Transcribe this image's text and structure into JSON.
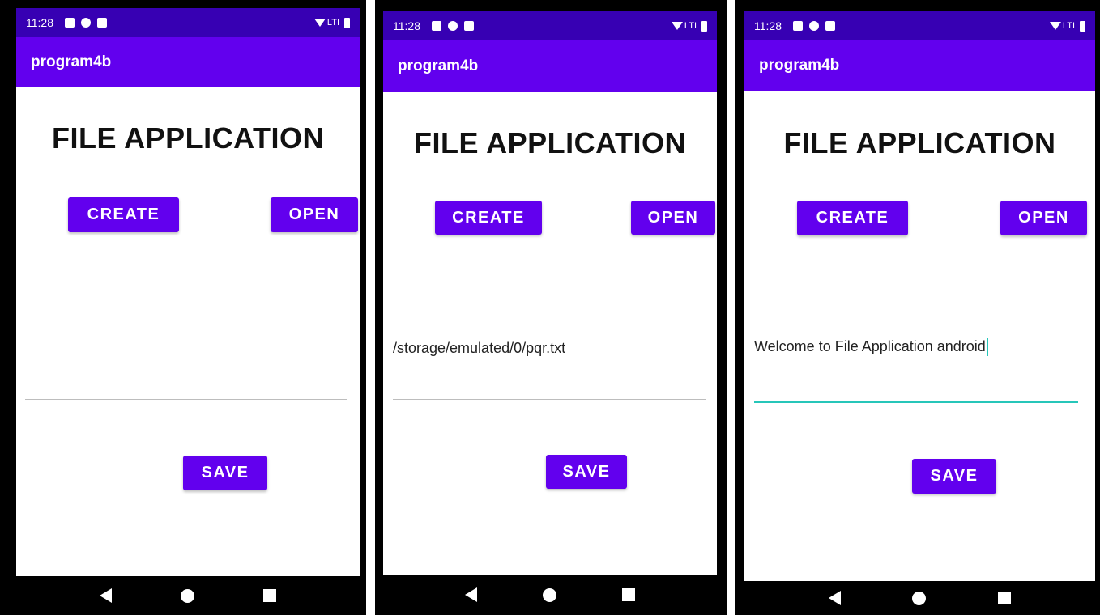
{
  "status_time": "11:28",
  "signal_text": "LTI",
  "app_title": "program4b",
  "heading": "FILE APPLICATION",
  "buttons": {
    "create": "CREATE",
    "open": "OPEN",
    "save": "SAVE"
  },
  "screens": [
    {
      "field_value": ""
    },
    {
      "field_value": "/storage/emulated/0/pqr.txt"
    },
    {
      "field_value": "Welcome to File Application android"
    }
  ],
  "colors": {
    "status_bar": "#3700b3",
    "app_bar": "#6200ee",
    "button": "#6200ee",
    "focus_line": "#26c6b9"
  }
}
